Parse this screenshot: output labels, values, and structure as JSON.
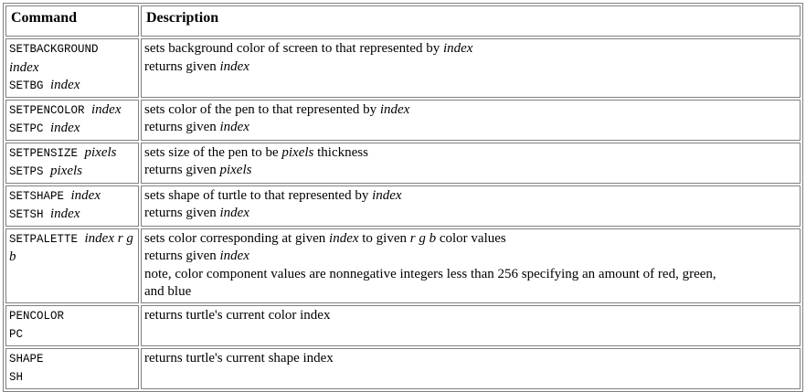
{
  "headers": {
    "command": "Command",
    "description": "Description"
  },
  "rows": [
    {
      "cmd": [
        {
          "parts": [
            {
              "t": "SETBACKGROUND",
              "s": "mono"
            }
          ]
        },
        {
          "parts": [
            {
              "t": "index",
              "s": "it"
            }
          ]
        },
        {
          "parts": [
            {
              "t": "SETBG ",
              "s": "mono"
            },
            {
              "t": "index",
              "s": "it"
            }
          ]
        }
      ],
      "desc": [
        {
          "parts": [
            {
              "t": "sets background color of screen to that represented by "
            },
            {
              "t": "index",
              "s": "it"
            }
          ]
        },
        {
          "parts": [
            {
              "t": "returns given "
            },
            {
              "t": "index",
              "s": "it"
            }
          ]
        }
      ]
    },
    {
      "cmd": [
        {
          "parts": [
            {
              "t": "SETPENCOLOR ",
              "s": "mono"
            },
            {
              "t": "index",
              "s": "it"
            }
          ]
        },
        {
          "parts": [
            {
              "t": "SETPC ",
              "s": "mono"
            },
            {
              "t": "index",
              "s": "it"
            }
          ]
        }
      ],
      "desc": [
        {
          "parts": [
            {
              "t": "sets color of the pen to that represented by "
            },
            {
              "t": "index",
              "s": "it"
            }
          ]
        },
        {
          "parts": [
            {
              "t": "returns given "
            },
            {
              "t": "index",
              "s": "it"
            }
          ]
        }
      ]
    },
    {
      "cmd": [
        {
          "parts": [
            {
              "t": "SETPENSIZE ",
              "s": "mono"
            },
            {
              "t": "pixels",
              "s": "it"
            }
          ]
        },
        {
          "parts": [
            {
              "t": "SETPS ",
              "s": "mono"
            },
            {
              "t": "pixels",
              "s": "it"
            }
          ]
        }
      ],
      "desc": [
        {
          "parts": [
            {
              "t": "sets size of the pen to be "
            },
            {
              "t": "pixels",
              "s": "it"
            },
            {
              "t": " thickness"
            }
          ]
        },
        {
          "parts": [
            {
              "t": "returns given "
            },
            {
              "t": "pixels",
              "s": "it"
            }
          ]
        }
      ]
    },
    {
      "cmd": [
        {
          "parts": [
            {
              "t": "SETSHAPE ",
              "s": "mono"
            },
            {
              "t": "index",
              "s": "it"
            }
          ]
        },
        {
          "parts": [
            {
              "t": "SETSH ",
              "s": "mono"
            },
            {
              "t": "index",
              "s": "it"
            }
          ]
        }
      ],
      "desc": [
        {
          "parts": [
            {
              "t": "sets shape of turtle to that represented by "
            },
            {
              "t": "index",
              "s": "it"
            }
          ]
        },
        {
          "parts": [
            {
              "t": "returns given "
            },
            {
              "t": "index",
              "s": "it"
            }
          ]
        }
      ]
    },
    {
      "cmd": [
        {
          "parts": [
            {
              "t": "SETPALETTE ",
              "s": "mono"
            },
            {
              "t": "index r g",
              "s": "it"
            }
          ]
        },
        {
          "parts": [
            {
              "t": "b",
              "s": "it"
            }
          ]
        }
      ],
      "desc": [
        {
          "parts": [
            {
              "t": "sets color corresponding at given "
            },
            {
              "t": "index",
              "s": "it"
            },
            {
              "t": " to given "
            },
            {
              "t": "r g b",
              "s": "it"
            },
            {
              "t": " color values"
            }
          ]
        },
        {
          "parts": [
            {
              "t": "returns given "
            },
            {
              "t": "index",
              "s": "it"
            }
          ]
        },
        {
          "parts": [
            {
              "t": "note, color component values are nonnegative integers less than 256 specifying an amount of red, green,"
            }
          ]
        },
        {
          "parts": [
            {
              "t": "and blue"
            }
          ]
        }
      ]
    },
    {
      "cmd": [
        {
          "parts": [
            {
              "t": "PENCOLOR",
              "s": "mono"
            }
          ]
        },
        {
          "parts": [
            {
              "t": "PC",
              "s": "mono"
            }
          ]
        }
      ],
      "desc": [
        {
          "parts": [
            {
              "t": "returns turtle's current color index"
            }
          ]
        }
      ]
    },
    {
      "cmd": [
        {
          "parts": [
            {
              "t": "SHAPE",
              "s": "mono"
            }
          ]
        },
        {
          "parts": [
            {
              "t": "SH",
              "s": "mono"
            }
          ]
        }
      ],
      "desc": [
        {
          "parts": [
            {
              "t": "returns turtle's current shape index"
            }
          ]
        }
      ]
    }
  ]
}
